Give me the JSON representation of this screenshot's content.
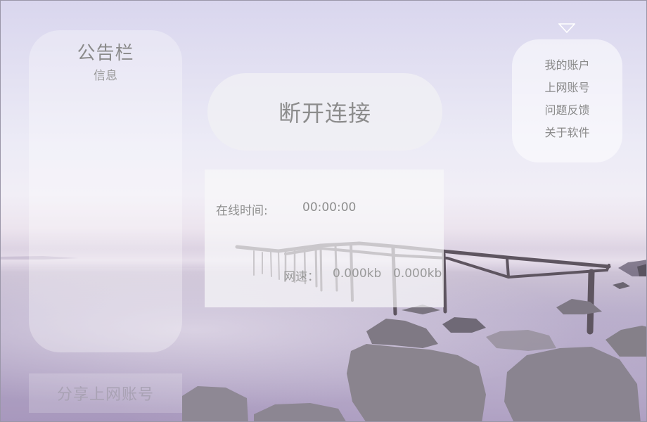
{
  "notice": {
    "title": "公告栏",
    "subtitle": "信息"
  },
  "connection": {
    "disconnect_label": "断开连接"
  },
  "status": {
    "online_label": "在线时间:",
    "online_value": "00:00:00",
    "speed_label": "网速：",
    "speed_up": "0.000kb",
    "speed_down": "0.000kb"
  },
  "menu": {
    "toggle_icon": "triangle-down-icon",
    "items": [
      {
        "label": "我的账户"
      },
      {
        "label": "上网账号"
      },
      {
        "label": "问题反馈"
      },
      {
        "label": "关于软件"
      }
    ]
  },
  "share": {
    "label": "分享上网账号"
  },
  "colors": {
    "text_primary": "#8a8a8a",
    "share_text": "#a9a2b4"
  }
}
